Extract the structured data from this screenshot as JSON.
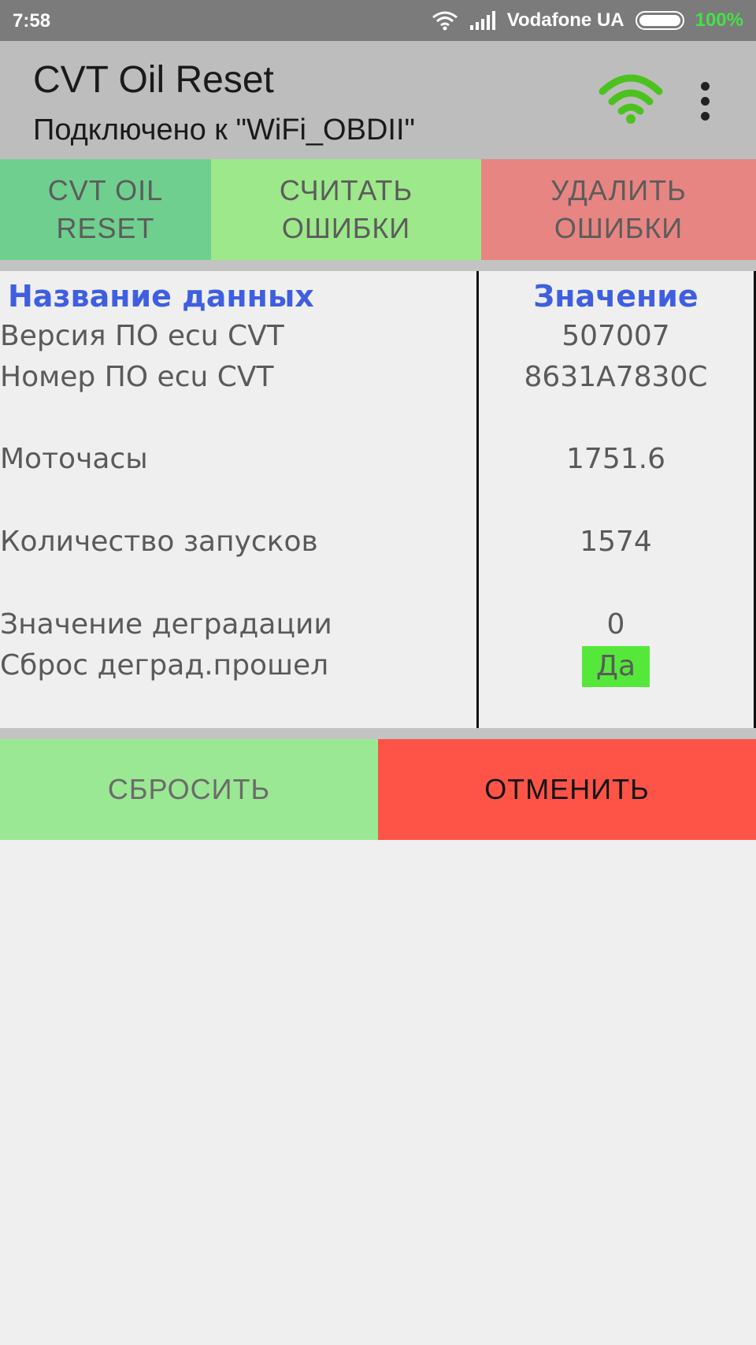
{
  "status_bar": {
    "time": "7:58",
    "carrier": "Vodafone UA",
    "battery": "100%"
  },
  "app_bar": {
    "title": "CVT Oil Reset",
    "subtitle": "Подключено к \"WiFi_OBDII\"",
    "wifi_icon": "wifi-icon",
    "menu_icon": "more-vert-icon"
  },
  "tabs": [
    {
      "line1": "CVT OIL",
      "line2": "RESET"
    },
    {
      "line1": "СЧИТАТЬ",
      "line2": "ОШИБКИ"
    },
    {
      "line1": "УДАЛИТЬ",
      "line2": "ОШИБКИ"
    }
  ],
  "table": {
    "header_name": "Название данных",
    "header_value": "Значение",
    "rows": [
      {
        "name": "Версия ПО ecu CVT",
        "value": "507007"
      },
      {
        "name": "Номер ПО ecu CVT",
        "value": "8631A7830C"
      },
      {
        "name": "Моточасы",
        "value": "1751.6"
      },
      {
        "name": "Количество запусков",
        "value": "1574"
      },
      {
        "name": "Значение деградации",
        "value": "0"
      },
      {
        "name": "Сброс деград.прошел",
        "value": "Да"
      }
    ]
  },
  "buttons": {
    "reset": "СБРОСИТЬ",
    "cancel": "ОТМЕНИТЬ"
  },
  "colors": {
    "accent_header": "#3f5fe0",
    "tab1": "#6fcf8e",
    "tab2": "#9ce88a",
    "tab3": "#e78582",
    "reset_btn": "#9ae893",
    "cancel_btn": "#fe5448",
    "yes_badge": "#55e83b",
    "wifi_green": "#4cc21f"
  }
}
